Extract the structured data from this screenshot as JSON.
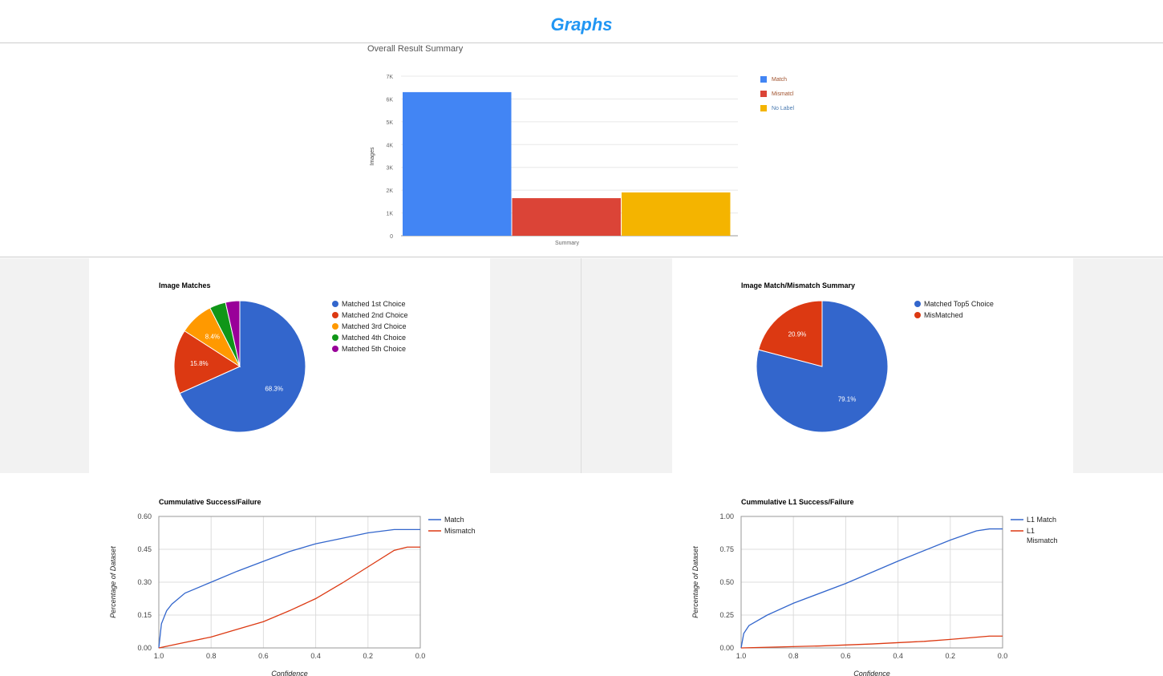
{
  "page": {
    "title": "Graphs"
  },
  "chart_data": [
    {
      "type": "bar",
      "title": "Overall Result Summary",
      "xlabel": "Summary",
      "ylabel": "Images",
      "ylim": [
        0,
        7000
      ],
      "yticks": [
        "0",
        "1K",
        "2K",
        "3K",
        "4K",
        "5K",
        "6K",
        "7K"
      ],
      "series": [
        {
          "name": "Match",
          "value": 6300,
          "color": "#4285f4"
        },
        {
          "name": "Mismatcl",
          "value": 1650,
          "color": "#db4437"
        },
        {
          "name": "No Label",
          "value": 1900,
          "color": "#f4b400"
        }
      ]
    },
    {
      "type": "pie",
      "title": "Image Matches",
      "slices": [
        {
          "name": "Matched 1st Choice",
          "value": 68.3,
          "label": "68.3%",
          "color": "#3366cc"
        },
        {
          "name": "Matched 2nd Choice",
          "value": 15.8,
          "label": "15.8%",
          "color": "#dc3912"
        },
        {
          "name": "Matched 3rd Choice",
          "value": 8.4,
          "label": "8.4%",
          "color": "#ff9900"
        },
        {
          "name": "Matched 4th Choice",
          "value": 4.0,
          "label": "",
          "color": "#109618"
        },
        {
          "name": "Matched 5th Choice",
          "value": 3.5,
          "label": "",
          "color": "#990099"
        }
      ]
    },
    {
      "type": "pie",
      "title": "Image Match/Mismatch Summary",
      "slices": [
        {
          "name": "Matched Top5 Choice",
          "value": 79.1,
          "label": "79.1%",
          "color": "#3366cc"
        },
        {
          "name": "MisMatched",
          "value": 20.9,
          "label": "20.9%",
          "color": "#dc3912"
        }
      ]
    },
    {
      "type": "line",
      "title": "Cummulative Success/Failure",
      "xlabel": "Confidence",
      "ylabel": "Percentage of Dataset",
      "xlim": [
        1.0,
        0.0
      ],
      "ylim": [
        0,
        0.6
      ],
      "xticks": [
        "1.0",
        "0.8",
        "0.6",
        "0.4",
        "0.2",
        "0.0"
      ],
      "yticks": [
        "0.00",
        "0.15",
        "0.30",
        "0.45",
        "0.60"
      ],
      "series": [
        {
          "name": "Match",
          "color": "#3366cc",
          "points": [
            [
              1.0,
              0
            ],
            [
              0.99,
              0.11
            ],
            [
              0.97,
              0.17
            ],
            [
              0.95,
              0.2
            ],
            [
              0.9,
              0.25
            ],
            [
              0.8,
              0.3
            ],
            [
              0.7,
              0.35
            ],
            [
              0.6,
              0.395
            ],
            [
              0.5,
              0.44
            ],
            [
              0.4,
              0.475
            ],
            [
              0.3,
              0.5
            ],
            [
              0.2,
              0.525
            ],
            [
              0.1,
              0.54
            ],
            [
              0.0,
              0.54
            ]
          ]
        },
        {
          "name": "Mismatch",
          "color": "#dc3912",
          "points": [
            [
              1.0,
              0
            ],
            [
              0.9,
              0.025
            ],
            [
              0.8,
              0.05
            ],
            [
              0.7,
              0.085
            ],
            [
              0.6,
              0.12
            ],
            [
              0.5,
              0.17
            ],
            [
              0.4,
              0.225
            ],
            [
              0.3,
              0.295
            ],
            [
              0.2,
              0.37
            ],
            [
              0.1,
              0.445
            ],
            [
              0.05,
              0.46
            ],
            [
              0.0,
              0.46
            ]
          ]
        }
      ]
    },
    {
      "type": "line",
      "title": "Cummulative L1 Success/Failure",
      "xlabel": "Confidence",
      "ylabel": "Percentage of Dataset",
      "xlim": [
        1.0,
        0.0
      ],
      "ylim": [
        0,
        1.0
      ],
      "xticks": [
        "1.0",
        "0.8",
        "0.6",
        "0.4",
        "0.2",
        "0.0"
      ],
      "yticks": [
        "0.00",
        "0.25",
        "0.50",
        "0.75",
        "1.00"
      ],
      "series": [
        {
          "name": "L1 Match",
          "color": "#3366cc",
          "points": [
            [
              1.0,
              0
            ],
            [
              0.99,
              0.11
            ],
            [
              0.97,
              0.17
            ],
            [
              0.9,
              0.25
            ],
            [
              0.8,
              0.34
            ],
            [
              0.6,
              0.49
            ],
            [
              0.4,
              0.66
            ],
            [
              0.2,
              0.82
            ],
            [
              0.1,
              0.89
            ],
            [
              0.05,
              0.905
            ],
            [
              0.0,
              0.905
            ]
          ]
        },
        {
          "name": "L1 Mismatch",
          "color": "#dc3912",
          "points": [
            [
              1.0,
              0
            ],
            [
              0.7,
              0.015
            ],
            [
              0.5,
              0.03
            ],
            [
              0.3,
              0.05
            ],
            [
              0.2,
              0.065
            ],
            [
              0.05,
              0.09
            ],
            [
              0.0,
              0.09
            ]
          ]
        }
      ]
    }
  ]
}
